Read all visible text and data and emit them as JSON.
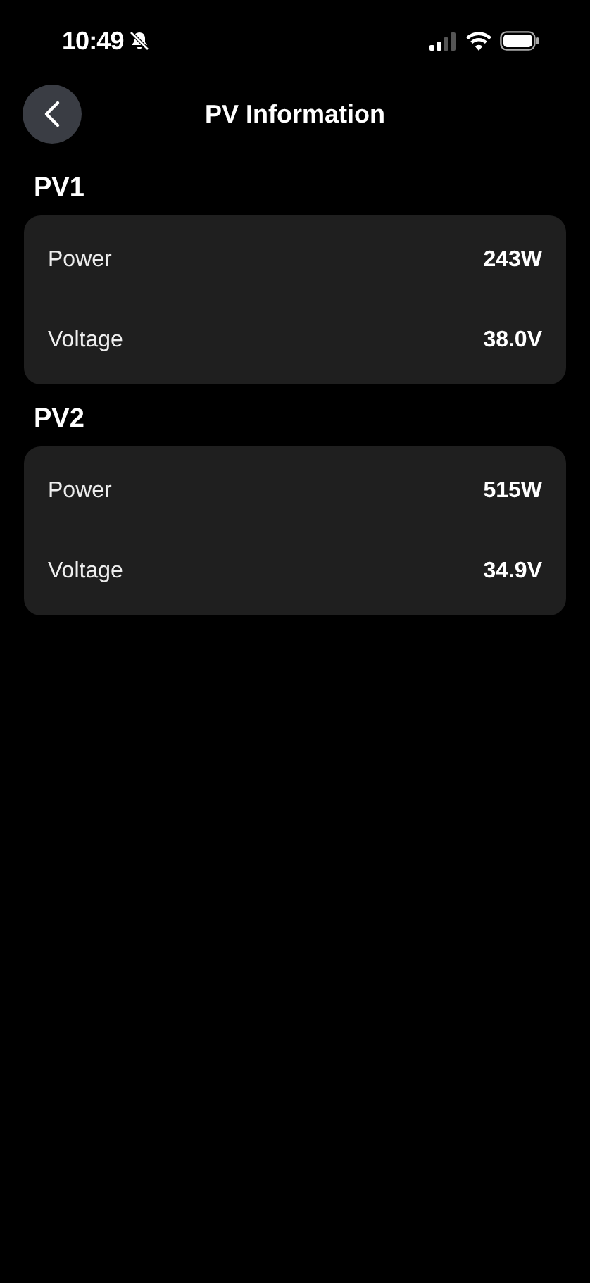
{
  "status_bar": {
    "time": "10:49"
  },
  "header": {
    "title": "PV Information"
  },
  "sections": [
    {
      "title": "PV1",
      "rows": [
        {
          "label": "Power",
          "value": "243W"
        },
        {
          "label": "Voltage",
          "value": "38.0V"
        }
      ]
    },
    {
      "title": "PV2",
      "rows": [
        {
          "label": "Power",
          "value": "515W"
        },
        {
          "label": "Voltage",
          "value": "34.9V"
        }
      ]
    }
  ]
}
